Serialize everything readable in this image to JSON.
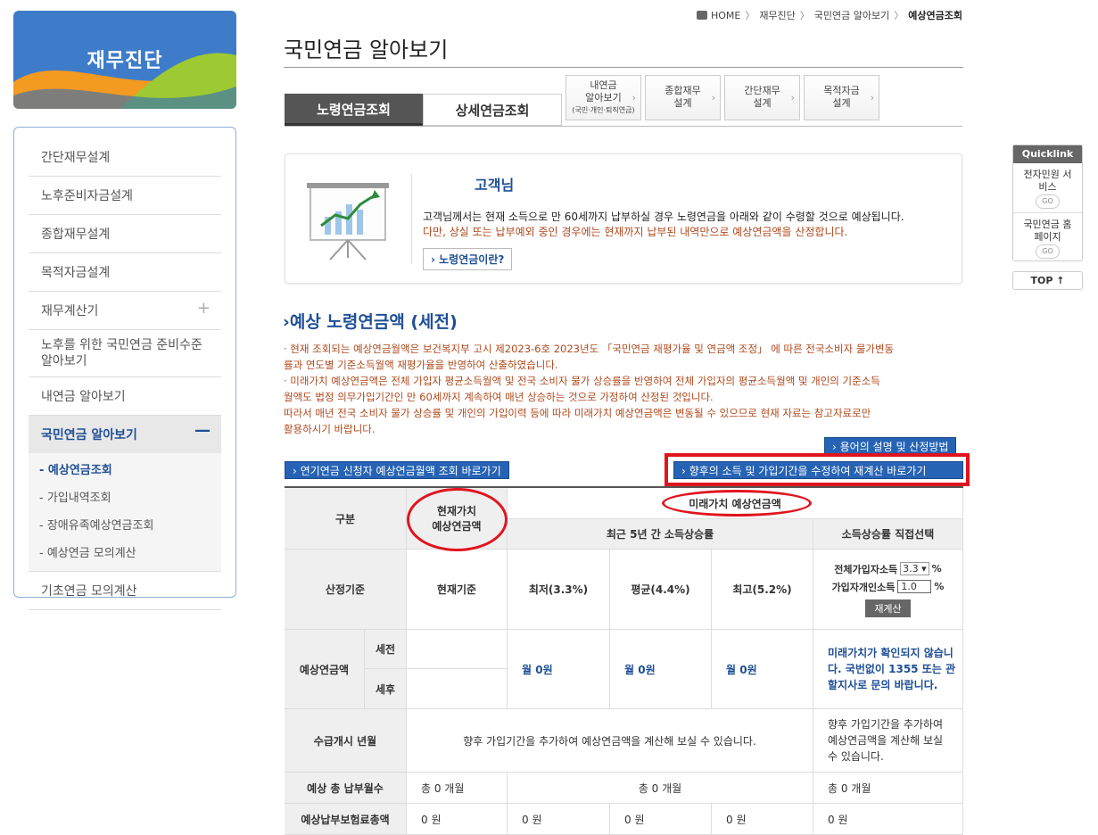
{
  "banner": {
    "title": "재무진단"
  },
  "leftnav": {
    "items": [
      "간단재무설계",
      "노후준비자금설계",
      "종합재무설계",
      "목적자금설계",
      "재무계산기",
      "노후를 위한 국민연금 준비수준 알아보기",
      "내연금 알아보기",
      "국민연금 알아보기"
    ],
    "subitems": [
      "- 예상연금조회",
      "- 가입내역조회",
      "- 장애유족예상연금조회",
      "- 예상연금 모의계산"
    ],
    "last": "기초연금 모의계산"
  },
  "breadcrumb": {
    "home": "HOME",
    "c1": "재무진단",
    "c2": "국민연금 알아보기",
    "current": "예상연금조회"
  },
  "page_title": "국민연금 알아보기",
  "tabs": {
    "t1": "노령연금조회",
    "t2": "상세연금조회"
  },
  "minitabs": [
    {
      "l1": "내연금",
      "l2": "알아보기",
      "l3": "(국민·개인·퇴직연금)"
    },
    {
      "l1": "종합재무",
      "l2": "설계",
      "l3": ""
    },
    {
      "l1": "간단재무",
      "l2": "설계",
      "l3": ""
    },
    {
      "l1": "목적자금",
      "l2": "설계",
      "l3": ""
    }
  ],
  "info": {
    "customer": "고객님",
    "text1": "고객님께서는 현재 소득으로 만 60세까지 납부하실 경우 노령연금을 아래와 같이 수령할 것으로 예상됩니다.",
    "text2": "다만, 상실 또는 납부예외 중인 경우에는 현재까지 납부된 내역만으로 예상연금액을 산정합니다.",
    "button": "› 노령연금이란?"
  },
  "section_title": "예상 노령연금액 (세전)",
  "notices": [
    "· 현재 조회되는 예상연금월액은 보건복지부 고시 제2023-6호 2023년도 「국민연금 재평가율 및 연금액 조정」 에 따른 전국소비자 물가변동",
    "  률과 연도별 기준소득월액 재평가율을 반영하여 산출하였습니다.",
    "· 미래가치 예상연금액은 전체 가입자 평균소득월액 및 전국 소비자 물가 상승률을 반영하여 전체 가입자의 평균소득월액 및 개인의 기준소득",
    "  월액도 법정 의무가입기간인 만 60세까지 계속하여 매년 상승하는 것으로 가정하여 산정된 것입니다.",
    "  따라서 매년 전국 소비자 물가 상승률 및 개인의 가입이력 등에 따라 미래가치 예상연금액은 변동될 수 있으므로 현재 자료는 참고자료로만",
    "  활용하시기 바랍니다."
  ],
  "buttons": {
    "terms": "› 용어의 설명 및 산정방법",
    "deferred": "› 연기연금 신청자 예상연금월액 조회 바로가기",
    "recalc_link": "› 향후의 소득 및 가입기간을 수정하여 재계산 바로가기"
  },
  "table": {
    "gubun": "구분",
    "current_value": "현재가치",
    "current_value2": "예상연금액",
    "future_value": "미래가치 예상연금액",
    "recent5": "최근 5년 간 소득상승률",
    "direct": "소득상승률 직접선택",
    "basis": "산정기준",
    "current_basis": "현재기준",
    "low": "최저(3.3%)",
    "avg": "평균(4.4%)",
    "high": "최고(5.2%)",
    "all_income_label": "전체가입자소득",
    "all_income_value": "3.3",
    "pct": "%",
    "personal_label": "가입자개인소득",
    "personal_value": "1.0",
    "recalc_button": "재계산",
    "expected": "예상연금액",
    "pretax": "세전",
    "aftertax": "세후",
    "month0": "월 0원",
    "future_note": "미래가치가 확인되지 않습니다. 국번없이 1355 또는 관할지사로 문의 바랍니다.",
    "start_label": "수급개시 년월",
    "start_text": "향후 가입기간을 추가하여 예상연금액을 계산해 보실 수 있습니다.",
    "start_text2": "향후 가입기간을 추가하여 예상연금액을 계산해 보실 수 있습니다.",
    "months_label": "예상 총 납부월수",
    "months_value": "총 0 개월",
    "premium_label": "예상납부보험료총액",
    "premium_value": "0 원"
  },
  "quicklink": {
    "title": "Quicklink",
    "item1": "전자민원 서비스",
    "item2": "국민연금 홈페이지",
    "go": "GO",
    "top": "TOP ↑"
  },
  "colors": {
    "accent": "#1f4f96",
    "notice": "#b0491d",
    "highlight": "#e0141e"
  }
}
